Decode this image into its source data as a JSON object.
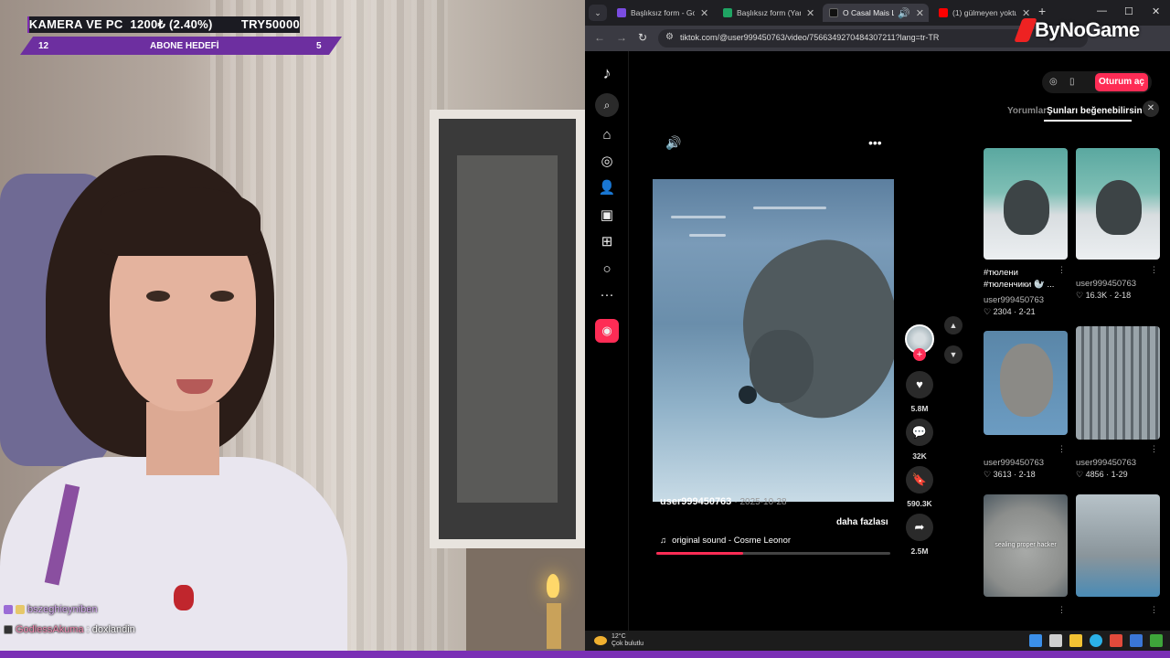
{
  "overlay": {
    "top_line": "KAMERA VE PC  1200₺ (2.40%)        TRY50000",
    "goal_left": "12",
    "goal_label": "ABONE HEDEFİ",
    "goal_right": "5"
  },
  "chat": [
    {
      "user": "bszeghieyniben",
      "message": ""
    },
    {
      "user": "GodlessAkuma",
      "message": ": doxlandin"
    }
  ],
  "browser": {
    "tabs": [
      {
        "title": "Başlıksız form - Go",
        "icon_color": "#7a4ce0"
      },
      {
        "title": "Başlıksız form (Yanı",
        "icon_color": "#1fa463"
      },
      {
        "title": "O Casal Mais Li",
        "icon_color": "#000000",
        "active": true
      },
      {
        "title": "(1) gülmeyen yoktu",
        "icon_color": "#ff0000"
      }
    ],
    "url": "tiktok.com/@user999450763/video/7566349270484307211?lang=tr-TR"
  },
  "watermark": "ByNoGame",
  "tiktok": {
    "video": {
      "author": "user999450763",
      "date": "2025-10-28",
      "more": "daha fazlası",
      "sound": "original sound - Cosme Leonor",
      "progress": 0.37
    },
    "actions": [
      {
        "name": "like",
        "icon": "heart-icon",
        "count": "5.8M"
      },
      {
        "name": "comment",
        "icon": "comment-icon",
        "count": "32K"
      },
      {
        "name": "bookmark",
        "icon": "bookmark-icon",
        "count": "590.3K"
      },
      {
        "name": "share",
        "icon": "share-icon",
        "count": "2.5M"
      }
    ],
    "login": "Oturum aç",
    "panel_tabs": {
      "comments": "Yorumlar",
      "suggested": "Şunları beğenebilirsin"
    },
    "suggestions": [
      {
        "title": "#тюлени #тюленчики 🦭 ...",
        "user": "user999450763",
        "likes": "2304",
        "date": "2-21"
      },
      {
        "title": "",
        "user": "user999450763",
        "likes": "16.3K",
        "date": "2-18"
      },
      {
        "title": "",
        "user": "user999450763",
        "likes": "3613",
        "date": "2-18"
      },
      {
        "title": "",
        "user": "user999450763",
        "likes": "4856",
        "date": "1-29"
      },
      {
        "title": "",
        "overlay_text": "sealing proper hacker"
      },
      {
        "title": ""
      }
    ]
  },
  "taskbar": {
    "weather_temp": "12°C",
    "weather_desc": "Çok bulutlu"
  }
}
